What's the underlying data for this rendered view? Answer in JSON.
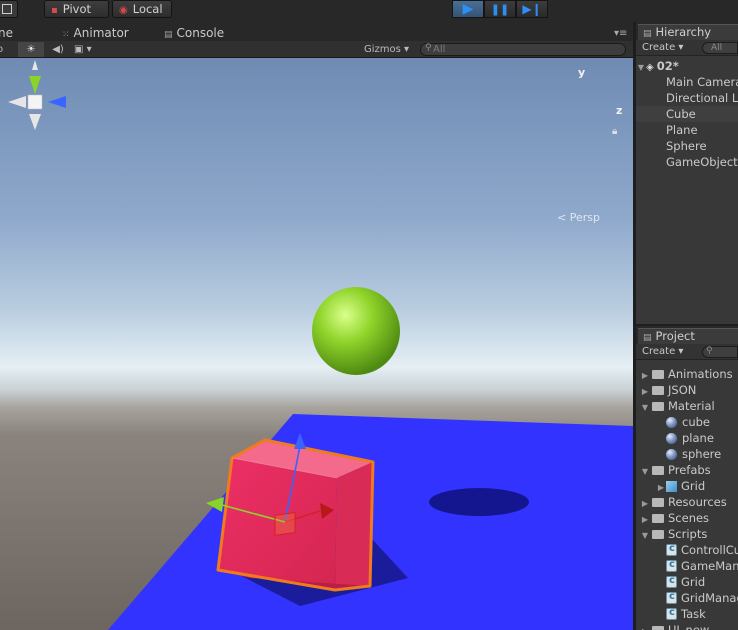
{
  "toolbar": {
    "pivot_label": "Pivot",
    "local_label": "Local",
    "play_icon": "play-icon",
    "pause_icon": "pause-icon",
    "step_icon": "step-icon"
  },
  "scene_tabs": {
    "scene_partial": "ne",
    "animator": "Animator",
    "console": "Console"
  },
  "scene_controls": {
    "gizmos_label": "Gizmos",
    "search_value": "All"
  },
  "viewport": {
    "persp_label": "Persp",
    "axis_y": "y",
    "axis_z": "z",
    "sphere_color": "#8fd42a",
    "cube_color": "#f0406a",
    "plane_color": "#3333ff",
    "selection_color": "#f07a1e"
  },
  "hierarchy": {
    "tab_label": "Hierarchy",
    "create_label": "Create",
    "search_value": "All",
    "scene_name": "02*",
    "items": [
      {
        "label": "Main Camera",
        "selected": false
      },
      {
        "label": "Directional Light",
        "selected": false
      },
      {
        "label": "Cube",
        "selected": true
      },
      {
        "label": "Plane",
        "selected": false
      },
      {
        "label": "Sphere",
        "selected": false
      },
      {
        "label": "GameObject",
        "selected": false
      }
    ]
  },
  "project": {
    "tab_label": "Project",
    "create_label": "Create",
    "items": [
      {
        "label": "Animations",
        "kind": "folder",
        "expanded": false,
        "depth": 0
      },
      {
        "label": "JSON",
        "kind": "folder",
        "expanded": false,
        "depth": 0
      },
      {
        "label": "Material",
        "kind": "folder",
        "expanded": true,
        "depth": 0
      },
      {
        "label": "cube",
        "kind": "material",
        "depth": 1
      },
      {
        "label": "plane",
        "kind": "material",
        "depth": 1
      },
      {
        "label": "sphere",
        "kind": "material",
        "depth": 1
      },
      {
        "label": "Prefabs",
        "kind": "folder",
        "expanded": true,
        "depth": 0
      },
      {
        "label": "Grid",
        "kind": "prefab",
        "depth": 1
      },
      {
        "label": "Resources",
        "kind": "folder",
        "expanded": false,
        "depth": 0
      },
      {
        "label": "Scenes",
        "kind": "folder",
        "expanded": false,
        "depth": 0
      },
      {
        "label": "Scripts",
        "kind": "folder",
        "expanded": true,
        "depth": 0
      },
      {
        "label": "ControllCube",
        "kind": "script",
        "depth": 1
      },
      {
        "label": "GameManager",
        "kind": "script",
        "depth": 1
      },
      {
        "label": "Grid",
        "kind": "script",
        "depth": 1
      },
      {
        "label": "GridManager",
        "kind": "script",
        "depth": 1
      },
      {
        "label": "Task",
        "kind": "script",
        "depth": 1
      },
      {
        "label": "UI_new",
        "kind": "folder",
        "expanded": false,
        "depth": 0
      }
    ]
  }
}
